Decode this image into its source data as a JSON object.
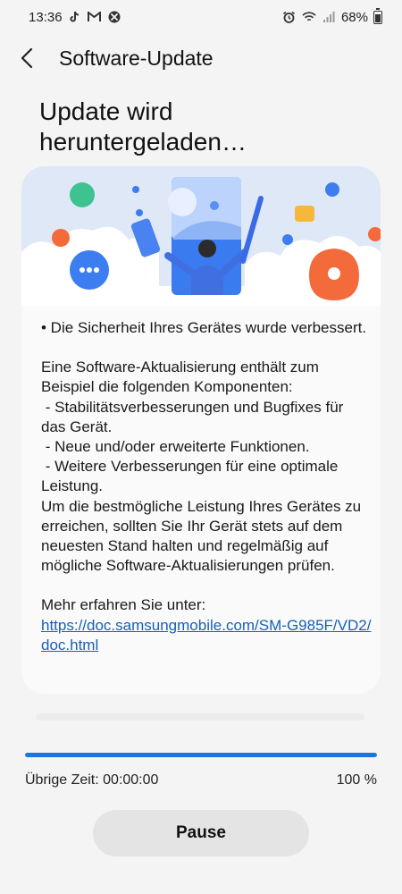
{
  "status_bar": {
    "time": "13:36",
    "battery": "68%",
    "left_icons": [
      "tiktok-icon",
      "gmail-icon",
      "xbox-icon"
    ],
    "right_icons": [
      "alarm-icon",
      "wifi-icon",
      "signal-icon",
      "battery-icon"
    ]
  },
  "header": {
    "title": "Software-Update"
  },
  "page": {
    "title": "Update wird heruntergeladen…"
  },
  "card": {
    "intro": "• Die Sicherheit Ihres Gerätes wurde verbessert.",
    "components_intro": "Eine Software-Aktualisierung enthält zum Beispiel die folgenden Komponenten:",
    "items": [
      " - Stabilitätsverbesserungen und Bugfixes für das Gerät.",
      " - Neue und/oder erweiterte Funktionen.",
      " - Weitere Verbesserungen für eine optimale Leistung."
    ],
    "recommendation": "Um die bestmögliche Leistung Ihres Gerätes zu erreichen, sollten Sie Ihr Gerät stets auf dem neuesten Stand halten und regelmäßig auf mögliche Software-Aktualisierungen prüfen.",
    "more_info": "Mehr erfahren Sie unter:",
    "link": "https://doc.samsungmobile.com/SM-G985F/VD2/doc.html"
  },
  "progress": {
    "fraction": 1.0,
    "remaining_time": "Übrige Zeit: 00:00:00",
    "percent": "100 %"
  },
  "actions": {
    "pause_label": "Pause"
  },
  "colors": {
    "accent": "#1a73e8",
    "background": "#f4f4f4",
    "card": "#fafafa",
    "link": "#1a5fb4"
  }
}
